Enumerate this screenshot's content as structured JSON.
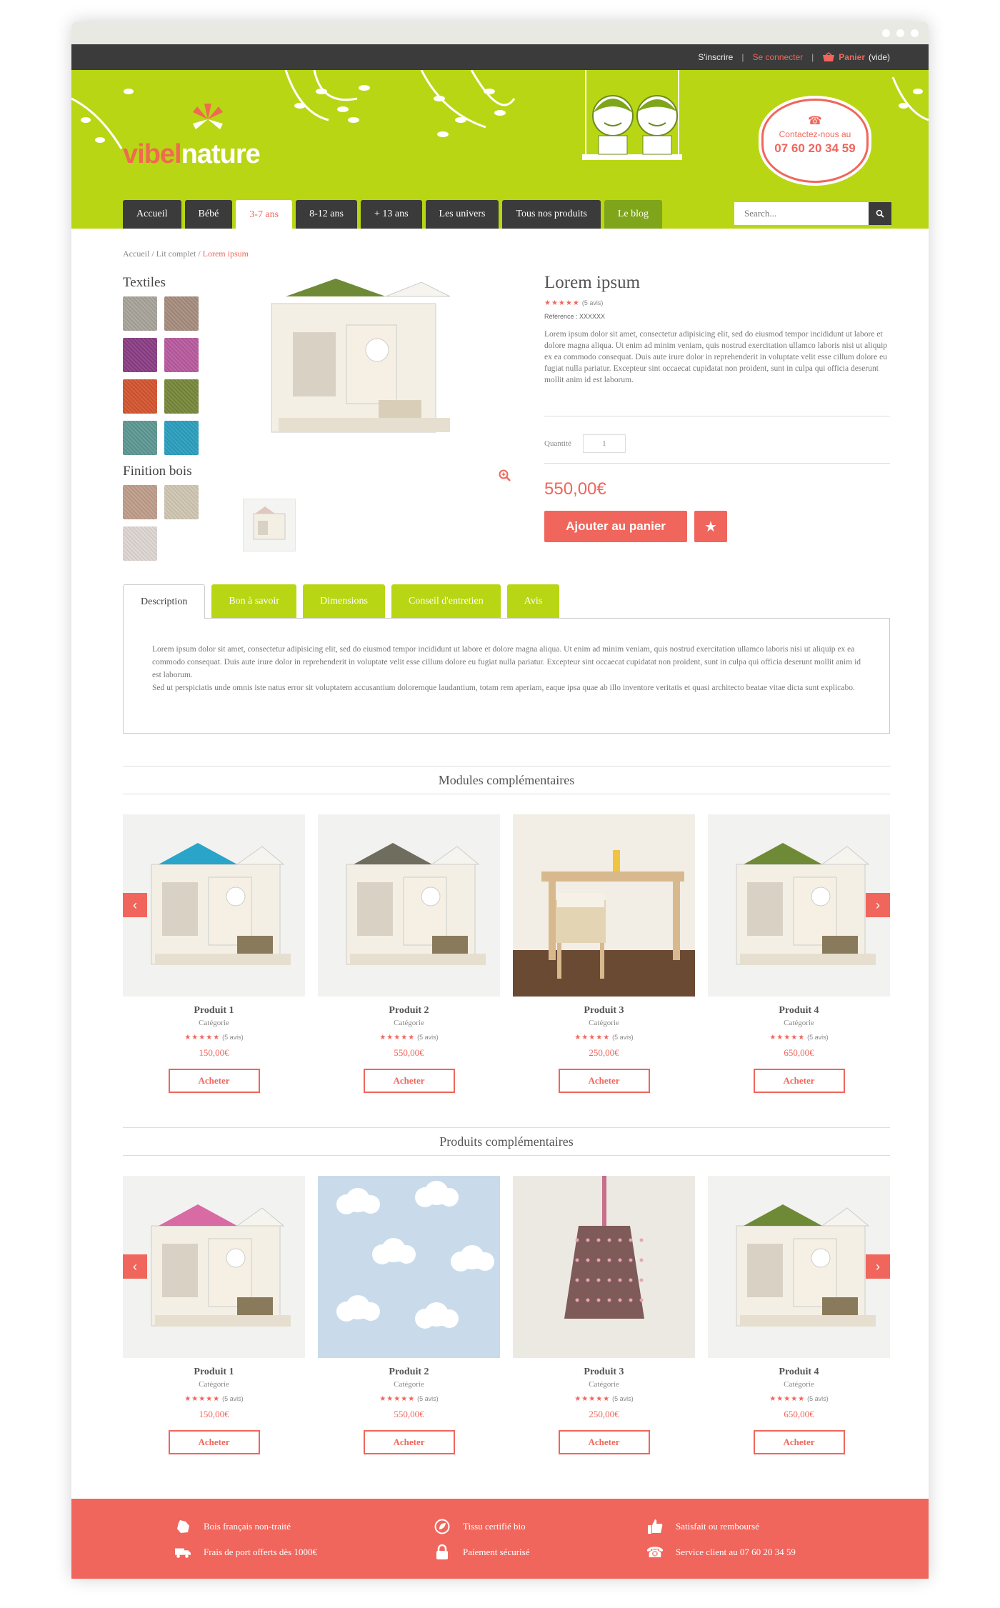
{
  "topbar": {
    "signup": "S'inscrire",
    "login": "Se connecter",
    "cart_label": "Panier",
    "cart_state": "(vide)"
  },
  "brand": {
    "part1": "vibel",
    "part2": "nature"
  },
  "contact": {
    "line1": "Contactez-nous au",
    "phone": "07 60 20 34 59"
  },
  "nav": {
    "items": [
      "Accueil",
      "Bébé",
      "3-7 ans",
      "8-12 ans",
      "+ 13 ans",
      "Les univers",
      "Tous nos produits",
      "Le blog"
    ],
    "active": "3-7 ans"
  },
  "search": {
    "placeholder": "Search..."
  },
  "breadcrumb": {
    "items": [
      "Accueil",
      "Lit complet",
      "Lorem ipsum"
    ]
  },
  "sidebar": {
    "textiles_title": "Textiles",
    "textiles": [
      "#a8a49b",
      "#a68c7d",
      "#8b3e85",
      "#b95a9f",
      "#d4552f",
      "#77883a",
      "#5e9893",
      "#2a9fbf"
    ],
    "bois_title": "Finition bois",
    "bois": [
      "#bf9d8a",
      "#cfc6b1",
      "#ddd6d2"
    ]
  },
  "product": {
    "title": "Lorem ipsum",
    "stars": "★★★★★",
    "reviews": "(5 avis)",
    "reference": "Référence : XXXXXX",
    "description": "Lorem ipsum dolor sit amet, consectetur adipisicing elit, sed do eiusmod tempor incididunt ut labore et dolore magna aliqua. Ut enim ad minim veniam, quis nostrud exercitation ullamco laboris nisi ut aliquip ex ea commodo consequat. Duis aute irure dolor in reprehenderit in voluptate velit esse cillum dolore eu fugiat nulla pariatur. Excepteur sint occaecat cupidatat non proident, sunt in culpa qui officia deserunt mollit anim id est laborum.",
    "qty_label": "Quantité",
    "qty": "1",
    "price": "550,00€",
    "add_to_cart": "Ajouter au panier",
    "fav_icon": "★"
  },
  "tabs": {
    "items": [
      "Description",
      "Bon à savoir",
      "Dimensions",
      "Conseil d'entretien",
      "Avis"
    ],
    "active": "Description",
    "content_p1": "Lorem ipsum dolor sit amet, consectetur adipisicing elit, sed do eiusmod tempor incididunt ut labore et dolore magna aliqua. Ut enim ad minim veniam, quis nostrud exercitation ullamco laboris nisi ut aliquip ex ea commodo consequat. Duis aute irure dolor in reprehenderit in voluptate velit esse cillum dolore eu fugiat nulla pariatur. Excepteur sint occaecat cupidatat non proident, sunt in culpa qui officia deserunt mollit anim id est laborum.",
    "content_p2": "Sed ut perspiciatis unde omnis iste natus error sit voluptatem accusantium doloremque laudantium, totam rem aperiam, eaque ipsa quae ab illo inventore veritatis et quasi architecto beatae vitae dicta sunt explicabo."
  },
  "modules": {
    "title": "Modules complémentaires",
    "items": [
      {
        "name": "Produit 1",
        "category": "Catégorie",
        "stars": "★★★★★",
        "reviews": "(5 avis)",
        "price": "150,00€",
        "buy": "Acheter",
        "roof": "#2aa4c9"
      },
      {
        "name": "Produit 2",
        "category": "Catégorie",
        "stars": "★★★★★",
        "reviews": "(5 avis)",
        "price": "550,00€",
        "buy": "Acheter",
        "roof": "#6e6d5e"
      },
      {
        "name": "Produit 3",
        "category": "Catégorie",
        "stars": "★★★★★",
        "reviews": "(5 avis)",
        "price": "250,00€",
        "buy": "Acheter",
        "roof": "#d8b98d"
      },
      {
        "name": "Produit 4",
        "category": "Catégorie",
        "stars": "★★★★★",
        "reviews": "(5 avis)",
        "price": "650,00€",
        "buy": "Acheter",
        "roof": "#6f8a36"
      }
    ]
  },
  "products": {
    "title": "Produits complémentaires",
    "items": [
      {
        "name": "Produit 1",
        "category": "Catégorie",
        "stars": "★★★★★",
        "reviews": "(5 avis)",
        "price": "150,00€",
        "buy": "Acheter",
        "roof": "#d86aa4"
      },
      {
        "name": "Produit 2",
        "category": "Catégorie",
        "stars": "★★★★★",
        "reviews": "(5 avis)",
        "price": "550,00€",
        "buy": "Acheter",
        "roof": "#c9dbea"
      },
      {
        "name": "Produit 3",
        "category": "Catégorie",
        "stars": "★★★★★",
        "reviews": "(5 avis)",
        "price": "250,00€",
        "buy": "Acheter",
        "roof": "#7e5a58"
      },
      {
        "name": "Produit 4",
        "category": "Catégorie",
        "stars": "★★★★★",
        "reviews": "(5 avis)",
        "price": "650,00€",
        "buy": "Acheter",
        "roof": "#6f8a36"
      }
    ]
  },
  "footer": {
    "items": [
      "Bois français non-traité",
      "Frais de port offerts dès 1000€",
      "Tissu certifié bio",
      "Paiement sécurisé",
      "Satisfait ou remboursé",
      "Service client au 07 60 20 34 59"
    ]
  },
  "colors": {
    "accent": "#f0665c",
    "green": "#b9d614",
    "dark": "#3b3b3b"
  }
}
